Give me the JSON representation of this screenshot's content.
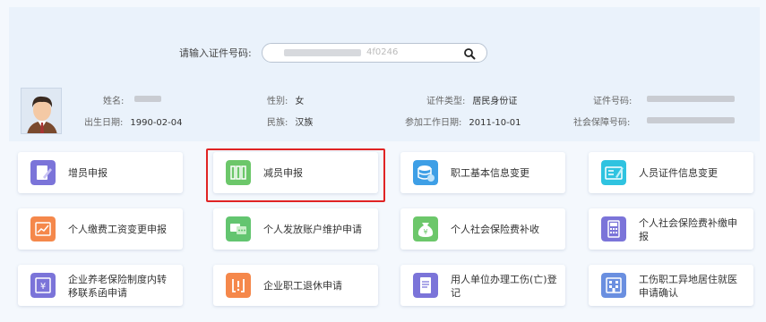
{
  "search": {
    "label": "请输入证件号码:",
    "value": "4f0246"
  },
  "person": {
    "row1": [
      {
        "label": "姓名:",
        "value": ""
      },
      {
        "label": "性别:",
        "value": "女"
      },
      {
        "label": "证件类型:",
        "value": "居民身份证"
      },
      {
        "label": "证件号码:",
        "value": ""
      }
    ],
    "row2": [
      {
        "label": "出生日期:",
        "value": "1990-02-04"
      },
      {
        "label": "民族:",
        "value": "汉族"
      },
      {
        "label": "参加工作日期:",
        "value": "2011-10-01"
      },
      {
        "label": "社会保障号码:",
        "value": ""
      }
    ]
  },
  "tiles": [
    {
      "label": "增员申报",
      "icon": "add-staff-icon",
      "color": "#7b74d9"
    },
    {
      "label": "减员申报",
      "icon": "reduce-staff-icon",
      "color": "#6cc76a"
    },
    {
      "label": "职工基本信息变更",
      "icon": "database-icon",
      "color": "#3e9fe6"
    },
    {
      "label": "人员证件信息变更",
      "icon": "id-card-icon",
      "color": "#2fc3e0"
    },
    {
      "label": "个人缴费工资变更申报",
      "icon": "salary-chart-icon",
      "color": "#f5884b"
    },
    {
      "label": "个人发放账户维护申请",
      "icon": "account-chat-icon",
      "color": "#63c570"
    },
    {
      "label": "个人社会保险费补收",
      "icon": "money-bag-icon",
      "color": "#6cc76a"
    },
    {
      "label": "个人社会保险费补缴申报",
      "icon": "calculator-icon",
      "color": "#7b74d9"
    },
    {
      "label": "企业养老保险制度内转移联系函申请",
      "icon": "pension-transfer-icon",
      "color": "#7b74d9"
    },
    {
      "label": "企业职工退休申请",
      "icon": "retire-icon",
      "color": "#f5884b"
    },
    {
      "label": "用人单位办理工伤(亡)登记",
      "icon": "document-icon",
      "color": "#7b74d9"
    },
    {
      "label": "工伤职工异地居住就医申请确认",
      "icon": "hospital-icon",
      "color": "#6a8fe0"
    }
  ]
}
